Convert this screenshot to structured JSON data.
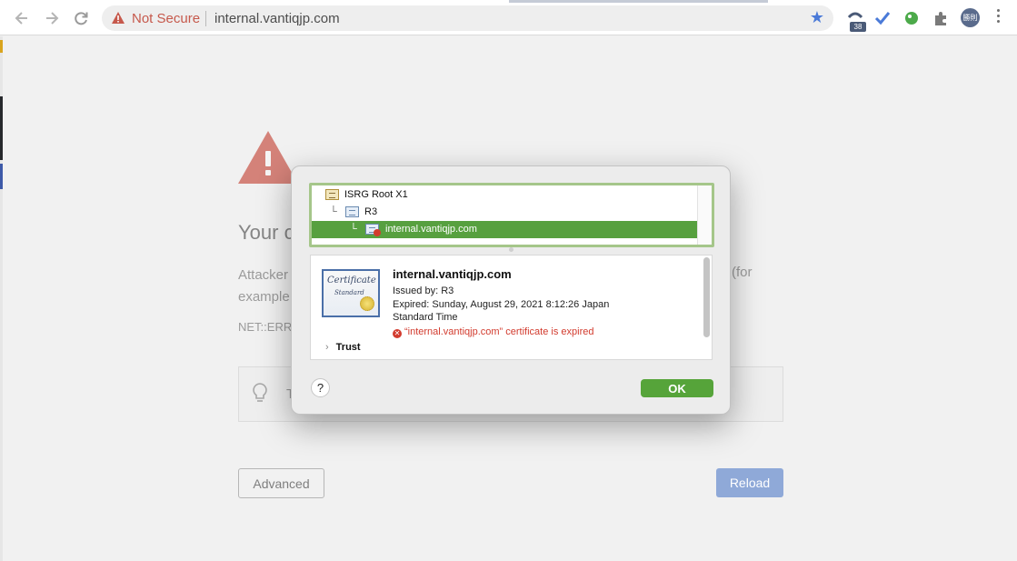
{
  "browser": {
    "security_label": "Not Secure",
    "url": "internal.vantiqjp.com",
    "extension_badge": "38",
    "profile_initials": "勝則",
    "icons": [
      "back-arrow-icon",
      "forward-arrow-icon",
      "reload-icon",
      "warning-triangle-icon",
      "bookmark-star-icon",
      "extension-icon",
      "checkmark-extension-icon",
      "evernote-icon",
      "puzzle-extensions-icon"
    ]
  },
  "error_page": {
    "title": "Your c",
    "body_line1": "Attacker",
    "body_line2": "example",
    "body_right": "(for",
    "error_code": "NET::ERR_",
    "tip_text": "T",
    "advanced_label": "Advanced",
    "reload_label": "Reload"
  },
  "dialog": {
    "chain": [
      {
        "label": "ISRG Root X1"
      },
      {
        "label": "R3"
      },
      {
        "label": "internal.vantiqjp.com",
        "selected": true
      }
    ],
    "certificate": {
      "image_title": "Certificate",
      "image_subtitle": "Standard",
      "name": "internal.vantiqjp.com",
      "issued_by": "Issued by: R3",
      "expired": "Expired: Sunday, August 29, 2021 8:12:26 Japan",
      "expired_cont": "Standard Time",
      "error": "“internal.vantiqjp.com” certificate is expired",
      "trust_label": "Trust"
    },
    "help_label": "?",
    "ok_label": "OK"
  },
  "colors": {
    "selection": "#57a03f",
    "ok_button": "#56a43a",
    "error_text": "#d23b2e",
    "not_secure": "#c6594c",
    "reload_button": "#8fa9d8"
  }
}
